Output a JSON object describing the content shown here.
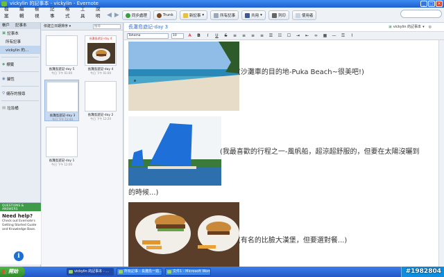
{
  "window": {
    "title": "vickylin 的記事本 - vickylin - Evernote"
  },
  "menu": [
    "檔案",
    "編輯",
    "檢視",
    "記事",
    "格式",
    "工具",
    "說明"
  ],
  "toolbar": {
    "sync": "同步處理",
    "trunk": "Trunk",
    "new_note": "新記事",
    "all_notes": "所有記事",
    "share": "共用",
    "print": "列印",
    "account": "使用者"
  },
  "sidebar": {
    "header": [
      "帳戶",
      "記事本"
    ],
    "items": [
      {
        "label": "記事本",
        "selected": false
      },
      {
        "label": "所有記事",
        "selected": false
      },
      {
        "label": "vickylin 的...",
        "selected": true
      },
      {
        "label": "標籤",
        "selected": false
      },
      {
        "label": "屬性",
        "selected": false
      },
      {
        "label": "儲存的搜尋",
        "selected": false
      },
      {
        "label": "垃圾桶",
        "selected": false
      }
    ]
  },
  "help": {
    "banner": "QUESTIONS & ANSWERS",
    "title": "Need help?",
    "body": "Check out Evernote's Getting Started Guide and Knowledge Base."
  },
  "notelist": {
    "sort_label": "依建立日期排序",
    "search_placeholder": "搜尋",
    "cards": [
      {
        "title": "長灘島遊記-day 5",
        "date": "今日 下午 01:00",
        "image": false,
        "selected": false,
        "header": ""
      },
      {
        "title": "長灘島遊記-day 4",
        "date": "今日 下午 01:00",
        "image": true,
        "selected": false,
        "header": "長灘島遊記-day 4"
      },
      {
        "title": "長灘島遊記-day 3",
        "date": "今日 下午 12:40",
        "image": false,
        "selected": true,
        "header": ""
      },
      {
        "title": "長灘島遊記-day 2",
        "date": "今日 下午 12:20",
        "image": false,
        "selected": false,
        "header": ""
      },
      {
        "title": "長灘島遊記-day 1",
        "date": "今日 下午 12:00",
        "image": false,
        "selected": false,
        "header": ""
      }
    ]
  },
  "editor": {
    "note_title": "長灘島遊記-day 3",
    "notebook": "vickylin 的記事本",
    "font": "Tahoma",
    "font_size": "10",
    "captions": [
      "(沙灘車的目的地-Puka Beach~很美吧!)",
      "(我最喜歡的行程之一-風帆船，超涼超舒服的，但要在太陽沒曬到",
      "的時候...)",
      "(有名的比臉大漢堡，但要選對餐...)"
    ]
  },
  "taskbar": {
    "start": "開始",
    "tasks": [
      "vickylin 的記事本 - ...",
      "所有記事 - 長灘島一週...",
      "文件1 - Microsoft Word"
    ]
  },
  "watermark": "#1982804",
  "colors": {
    "accent": "#2356c8",
    "title": "#3a6fc4",
    "help_banner": "#3f9a4a"
  }
}
